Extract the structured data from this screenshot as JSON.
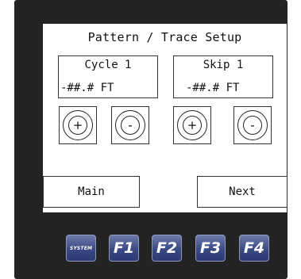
{
  "screen": {
    "title": "Pattern / Trace Setup",
    "cycle": {
      "label": "Cycle 1",
      "value": "-##.# FT"
    },
    "skip": {
      "label": "Skip 1",
      "value": "-##.# FT"
    },
    "controls": {
      "cycle_increment": "+",
      "cycle_decrement": "-",
      "skip_increment": "+",
      "skip_decrement": "-"
    },
    "buttons": {
      "main": "Main",
      "next": "Next"
    }
  },
  "function_keys": [
    "SYSTEM",
    "F1",
    "F2",
    "F3",
    "F4"
  ]
}
